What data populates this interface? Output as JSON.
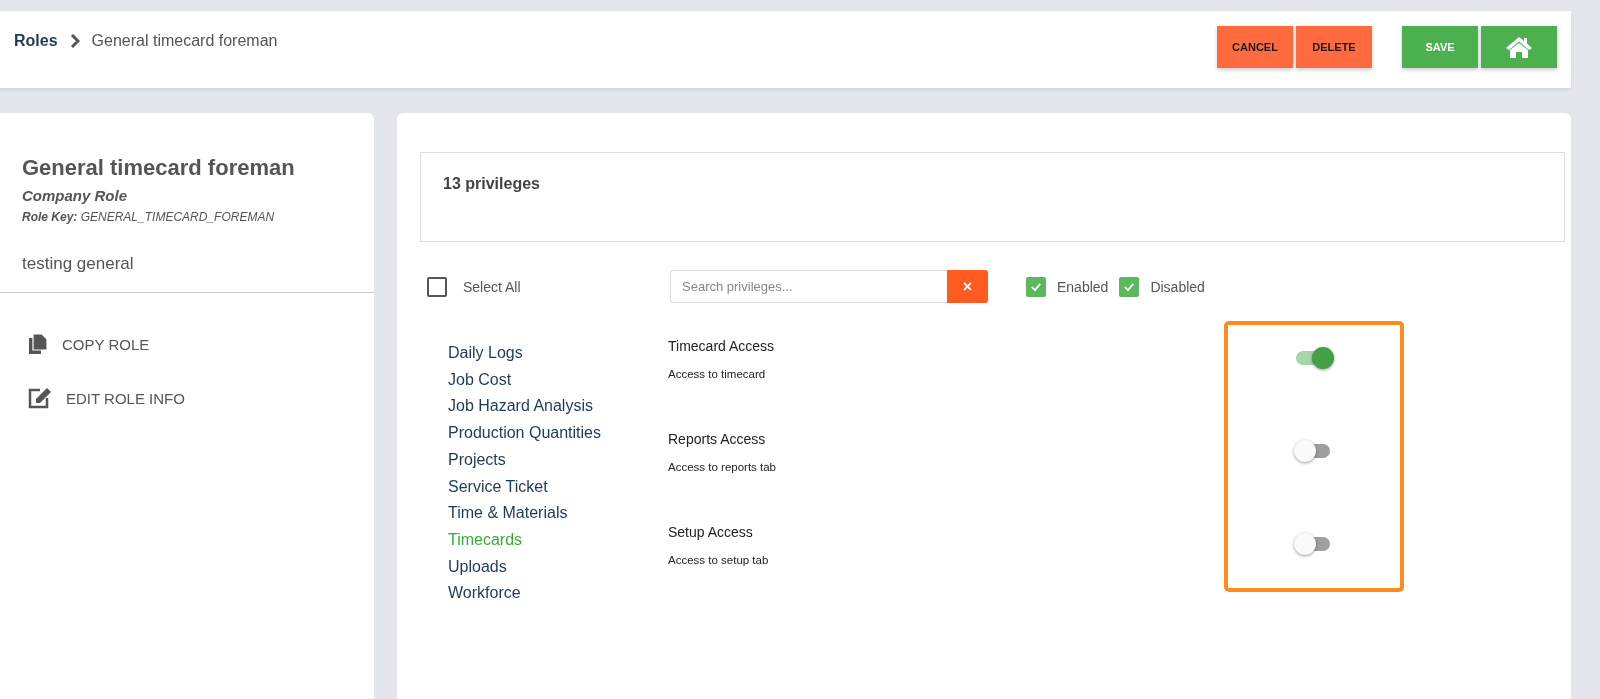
{
  "breadcrumb": {
    "root": "Roles",
    "current": "General timecard foreman"
  },
  "actions": [
    {
      "kind": "danger",
      "label": "CANCEL"
    },
    {
      "kind": "danger",
      "label": "DELETE"
    },
    {
      "kind": "primary",
      "label": "SAVE"
    },
    {
      "kind": "home"
    }
  ],
  "role": {
    "name": "General timecard foreman",
    "type": "Company Role",
    "key_label": "Role Key:",
    "key": "GENERAL_TIMECARD_FOREMAN",
    "description": "testing general"
  },
  "role_actions": [
    {
      "kind": "copy",
      "label": "COPY ROLE"
    },
    {
      "kind": "edit",
      "label": "EDIT ROLE INFO"
    }
  ],
  "privileges_count": "13 privileges",
  "select_all": {
    "label": "Select All",
    "checked": false
  },
  "search": {
    "placeholder": "Search privileges...",
    "clear_label": "×"
  },
  "filters": [
    {
      "label": "Enabled",
      "checked": true
    },
    {
      "label": "Disabled",
      "checked": true
    }
  ],
  "categories": [
    {
      "label": "Daily Logs",
      "selected": false
    },
    {
      "label": "Job Cost",
      "selected": false
    },
    {
      "label": "Job Hazard Analysis",
      "selected": false
    },
    {
      "label": "Production Quantities",
      "selected": false
    },
    {
      "label": "Projects",
      "selected": false
    },
    {
      "label": "Service Ticket",
      "selected": false
    },
    {
      "label": "Time & Materials",
      "selected": false
    },
    {
      "label": "Timecards",
      "selected": true
    },
    {
      "label": "Uploads",
      "selected": false
    },
    {
      "label": "Workforce",
      "selected": false
    }
  ],
  "privileges": [
    {
      "name": "Timecard Access",
      "description": "Access to timecard",
      "on": true
    },
    {
      "name": "Reports Access",
      "description": "Access to reports tab",
      "on": false
    },
    {
      "name": "Setup Access",
      "description": "Access to setup tab",
      "on": false
    }
  ]
}
